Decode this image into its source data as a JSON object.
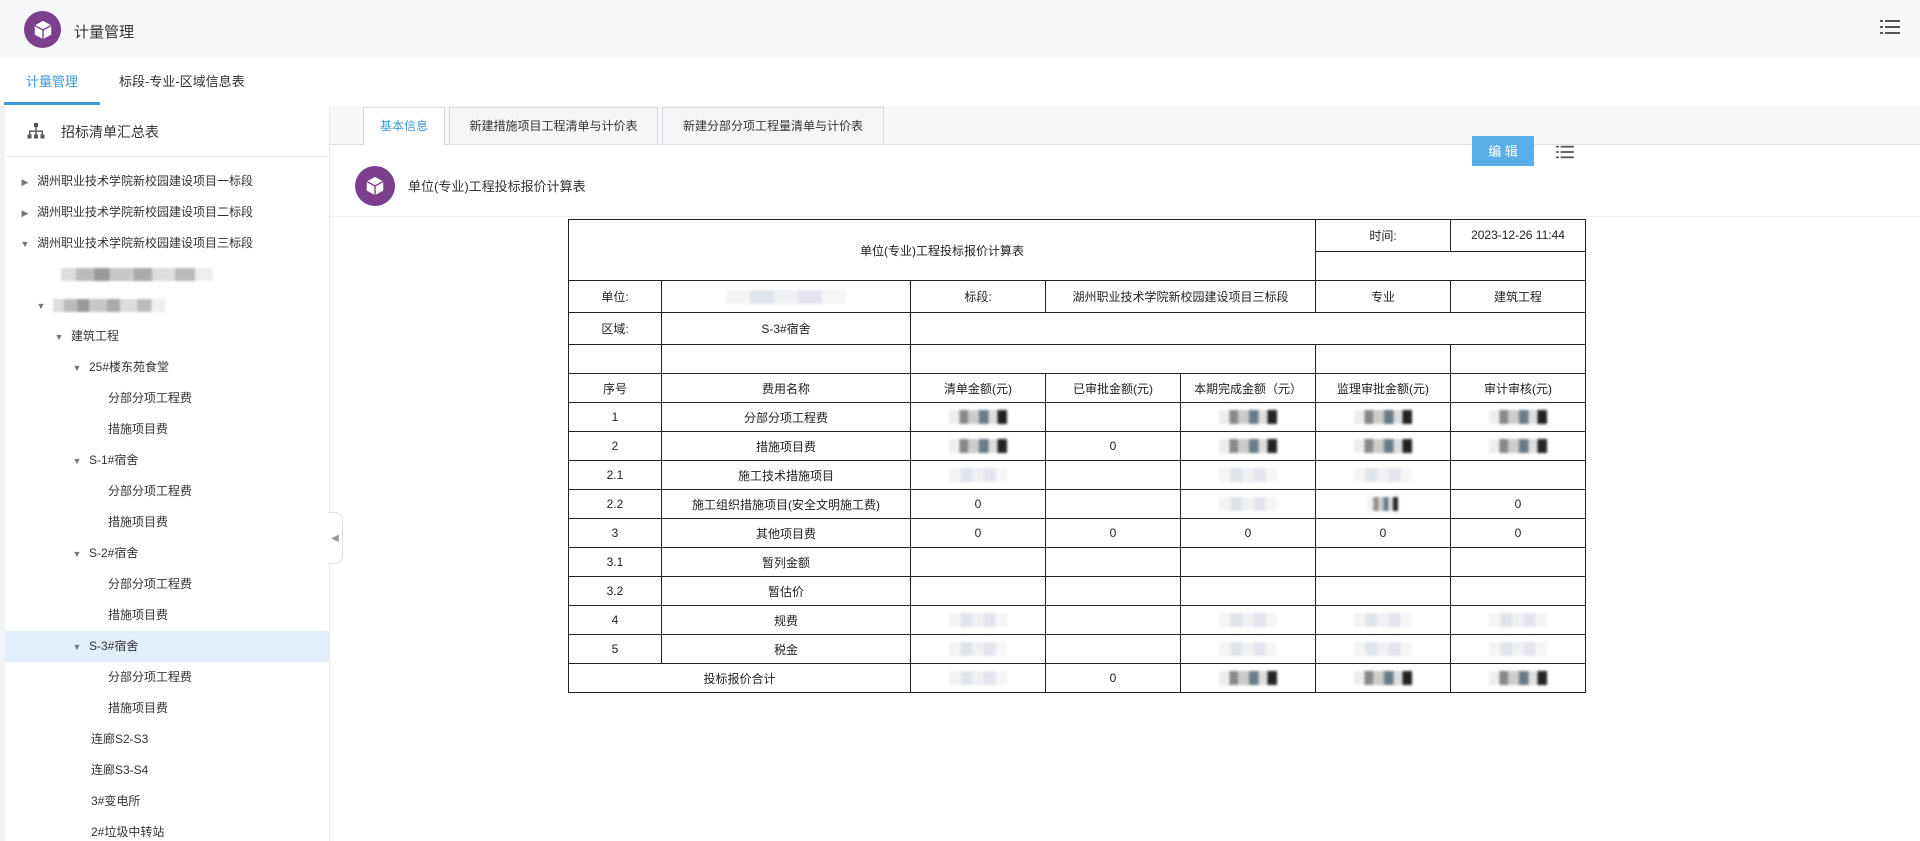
{
  "app": {
    "title": "计量管理"
  },
  "nav": {
    "tabs": [
      {
        "label": "计量管理"
      },
      {
        "label": "标段-专业-区域信息表"
      }
    ]
  },
  "sidebar": {
    "title": "招标清单汇总表",
    "tree": [
      {
        "label": "湖州职业技术学院新校园建设项目一标段"
      },
      {
        "label": "湖州职业技术学院新校园建设项目二标段"
      },
      {
        "label": "湖州职业技术学院新校园建设项目三标段"
      },
      {
        "label": "建筑工程"
      },
      {
        "label": "25#楼东苑食堂"
      },
      {
        "label": "分部分项工程费"
      },
      {
        "label": "措施项目费"
      },
      {
        "label": "S-1#宿舍"
      },
      {
        "label": "分部分项工程费"
      },
      {
        "label": "措施项目费"
      },
      {
        "label": "S-2#宿舍"
      },
      {
        "label": "分部分项工程费"
      },
      {
        "label": "措施项目费"
      },
      {
        "label": "S-3#宿舍"
      },
      {
        "label": "分部分项工程费"
      },
      {
        "label": "措施项目费"
      },
      {
        "label": "连廊S2-S3"
      },
      {
        "label": "连廊S3-S4"
      },
      {
        "label": "3#变电所"
      },
      {
        "label": "2#垃圾中转站"
      }
    ]
  },
  "content_tabs": [
    {
      "label": "基本信息"
    },
    {
      "label": "新建措施项目工程清单与计价表"
    },
    {
      "label": "新建分部分项工程量清单与计价表"
    }
  ],
  "panel": {
    "title": "单位(专业)工程投标报价计算表",
    "edit_label": "编 辑"
  },
  "report": {
    "title": "单位(专业)工程投标报价计算表",
    "time_label": "时间:",
    "time_value": "2023-12-26 11:44",
    "unit_label": "单位:",
    "section_label": "标段:",
    "section_value": "湖州职业技术学院新校园建设项目三标段",
    "major_label": "专业",
    "major_value": "建筑工程",
    "area_label": "区域:",
    "area_value": "S-3#宿舍",
    "headers": [
      "序号",
      "费用名称",
      "清单金额(元)",
      "已审批金额(元)",
      "本期完成金额（元）",
      "监理审批金额(元)",
      "审计审核(元)"
    ],
    "rows": [
      {
        "no": "1",
        "name": "分部分项工程费",
        "c1": "",
        "c2": "",
        "c3": "",
        "c4": "",
        "c5": ""
      },
      {
        "no": "2",
        "name": "措施项目费",
        "c1": "",
        "c2": "0",
        "c3": "",
        "c4": "",
        "c5": ""
      },
      {
        "no": "2.1",
        "name": "施工技术措施项目",
        "c1": "",
        "c2": "",
        "c3": "",
        "c4": "",
        "c5": ""
      },
      {
        "no": "2.2",
        "name": "施工组织措施项目(安全文明施工费)",
        "c1": "0",
        "c2": "",
        "c3": "",
        "c4": "",
        "c5": "0"
      },
      {
        "no": "3",
        "name": "其他项目费",
        "c1": "0",
        "c2": "0",
        "c3": "0",
        "c4": "0",
        "c5": "0"
      },
      {
        "no": "3.1",
        "name": "暂列金额",
        "c1": "",
        "c2": "",
        "c3": "",
        "c4": "",
        "c5": ""
      },
      {
        "no": "3.2",
        "name": "暂估价",
        "c1": "",
        "c2": "",
        "c3": "",
        "c4": "",
        "c5": ""
      },
      {
        "no": "4",
        "name": "规费",
        "c1": "",
        "c2": "",
        "c3": "",
        "c4": "",
        "c5": ""
      },
      {
        "no": "5",
        "name": "税金",
        "c1": "",
        "c2": "",
        "c3": "",
        "c4": "",
        "c5": ""
      }
    ],
    "total_label": "投标报价合计",
    "total_c2": "0"
  },
  "colors": {
    "accent": "#3c9bd9",
    "brand": "#7b3f8e",
    "edit_button": "#5aaee8",
    "selected_row": "#e3eefb"
  },
  "icons": {
    "logo": "cube-icon",
    "menu": "list-menu-icon",
    "sidebar_head": "org-tree-icon"
  }
}
